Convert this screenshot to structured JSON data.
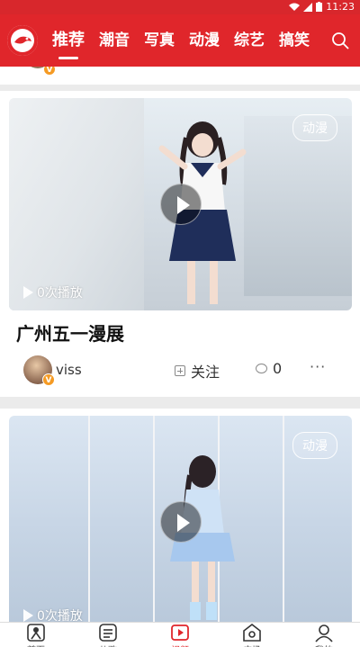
{
  "status_bar": {
    "time": "11:23"
  },
  "nav": {
    "tabs": [
      "推荐",
      "潮音",
      "写真",
      "动漫",
      "综艺",
      "搞笑"
    ],
    "active_tab": "推荐",
    "accent_color": "#e0262b"
  },
  "feed": {
    "posts": [
      {
        "tag": "动漫",
        "plays": "0次播放",
        "title": "广州五一漫展",
        "author": "viss",
        "follow_label": "关注",
        "comments": "0",
        "more": "···"
      },
      {
        "tag": "动漫",
        "plays": "0次播放"
      }
    ]
  },
  "bottom_bar": {
    "items": [
      "首页",
      "儿歌",
      "视频",
      "广场",
      "我的"
    ],
    "active": "视频"
  },
  "icons": [
    "logo-icon",
    "search-icon",
    "play-icon",
    "follow-plus-icon",
    "comment-icon",
    "more-icon",
    "home-icon",
    "song-icon",
    "video-icon",
    "square-icon",
    "profile-icon",
    "verified-badge-icon"
  ]
}
